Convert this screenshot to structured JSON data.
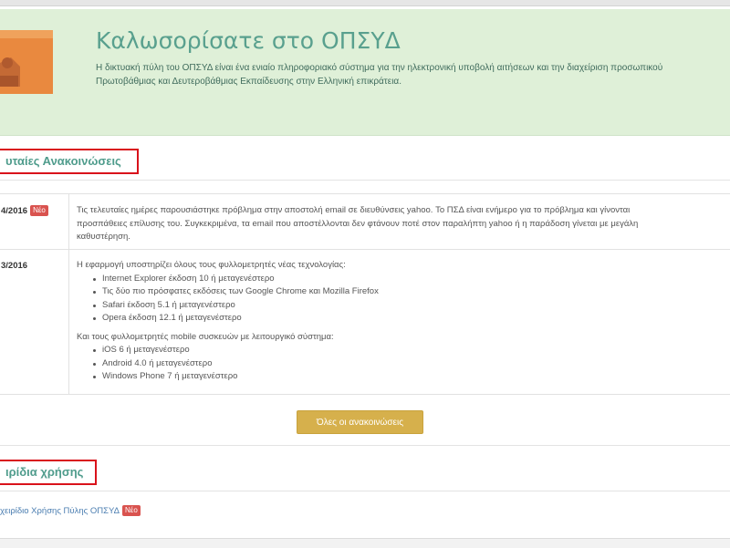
{
  "banner": {
    "title": "Καλωσορίσατε στο ΟΠΣΥΔ",
    "intro_line1": "Η δικτυακή πύλη του ΟΠΣΥΔ είναι ένα ενιαίο πληροφοριακό σύστημα για την ηλεκτρονική υποβολή αιτήσεων και την διαχείριση προσωπικού",
    "intro_line2": "Πρωτοβάθμιας και Δευτεροβάθμιας Εκπαίδευσης στην Ελληνική επικράτεια."
  },
  "announcements": {
    "heading": "υταίες Ανακοινώσεις",
    "items": [
      {
        "date": "4/2016",
        "badge": "Νέο",
        "lines": [
          "Τις τελευταίες ημέρες παρουσιάστηκε πρόβλημα στην αποστολή email σε διευθύνσεις yahoo. Το ΠΣΔ είναι ενήμερο για το πρόβλημα και γίνονται",
          "προσπάθειες επίλυσης του. Συγκεκριμένα, τα email που αποστέλλονται δεν φτάνουν ποτέ στον παραλήπτη yahoo ή η παράδοση γίνεται με μεγάλη",
          "καθυστέρηση."
        ]
      },
      {
        "date": "3/2016",
        "intro": "Η εφαρμογή υποστηρίζει όλους τους φυλλομετρητές νέας τεχνολογίας:",
        "desktop_browsers": [
          "Internet Explorer έκδοση 10 ή μεταγενέστερο",
          "Τις δύο πιο πρόσφατες εκδόσεις των Google Chrome και Mozilla Firefox",
          "Safari έκδοση 5.1 ή μεταγενέστερο",
          "Opera έκδοση 12.1 ή μεταγενέστερο"
        ],
        "mobile_intro": "Και τους φυλλομετρητές mobile συσκευών με λειτουργικό σύστημα:",
        "mobile_browsers": [
          "iOS 6 ή μεταγενέστερο",
          "Android 4.0 ή μεταγενέστερο",
          "Windows Phone 7 ή μεταγενέστερο"
        ]
      }
    ],
    "all_button": "Όλες οι ανακοινώσεις"
  },
  "manuals": {
    "heading": "ιρίδια χρήσης",
    "link_text": "χειρίδιο Χρήσης Πύλης ΟΠΣΥΔ",
    "badge": "Νέο"
  },
  "colors": {
    "banner_bg": "#dff0d8",
    "title_green": "#59a08e",
    "highlight_red": "#d9121b",
    "button_gold": "#d6b04c",
    "badge_red": "#d9534f"
  }
}
